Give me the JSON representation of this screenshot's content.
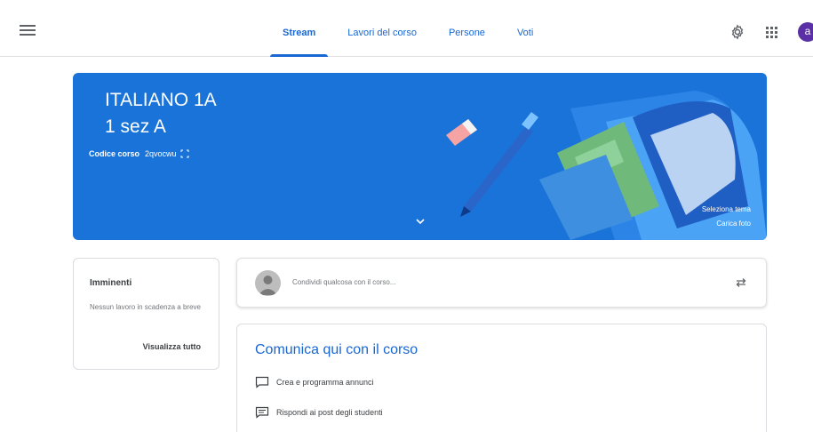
{
  "header": {
    "tabs": [
      {
        "label": "Stream",
        "active": true
      },
      {
        "label": "Lavori del corso",
        "active": false
      },
      {
        "label": "Persone",
        "active": false
      },
      {
        "label": "Voti",
        "active": false
      }
    ],
    "account_initial": "a",
    "accent_color": "#1967d2"
  },
  "banner": {
    "title": "ITALIANO 1A",
    "subtitle": "1 sez A",
    "code_label": "Codice corso",
    "code_value": "2qvocwu",
    "select_theme": "Seleziona tema",
    "upload_photo": "Carica foto",
    "color": "#1a73d9"
  },
  "upcoming": {
    "title": "Imminenti",
    "text": "Nessun lavoro in scadenza a breve",
    "link": "Visualizza tutto"
  },
  "share": {
    "placeholder": "Condividi qualcosa con il corso..."
  },
  "communicate": {
    "title": "Comunica qui con il corso",
    "items": [
      {
        "label": "Crea e programma annunci",
        "icon": "announcement-icon"
      },
      {
        "label": "Rispondi ai post degli studenti",
        "icon": "reply-post-icon"
      }
    ]
  }
}
